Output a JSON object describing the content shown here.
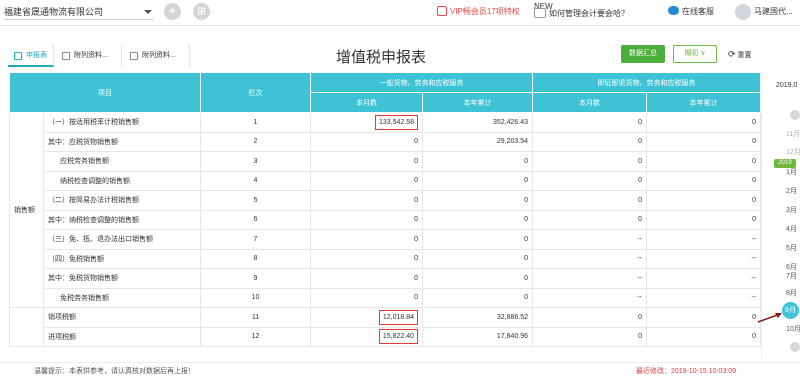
{
  "top": {
    "company": "福建省晟通物流有限公司",
    "add_glyph": "+",
    "apps_glyph": "⊞",
    "vip": "VIP畅会员17项特权",
    "tip_badge": "NEW",
    "tip": "如何管理会计要会哈？",
    "service": "在线客服",
    "user": "马建国代..."
  },
  "tabs": [
    "申报表",
    "附列资料...",
    "附列资料..."
  ],
  "title": "增值税申报表",
  "buttons": {
    "summary": "数据汇总",
    "period": "期初 ∨",
    "reset": "重置"
  },
  "table": {
    "h_item": "项目",
    "h_col": "栏次",
    "h_g1": "一般货物、劳务和应税服务",
    "h_g2": "即征即退货物、劳务和应税服务",
    "h_month": "本月数",
    "h_year": "本年累计",
    "group1": "销售额",
    "rows": [
      {
        "name": "（一）按适用税率计税销售额",
        "no": "1",
        "m1": "133,542.58",
        "y1": "352,426.43",
        "m2": "0",
        "y2": "0"
      },
      {
        "name": "其中：应税货物销售额",
        "no": "2",
        "m1": "0",
        "y1": "29,203.54",
        "m2": "0",
        "y2": "0"
      },
      {
        "name": "应税劳务销售额",
        "no": "3",
        "m1": "0",
        "y1": "0",
        "m2": "0",
        "y2": "0"
      },
      {
        "name": "纳税检查调整的销售额",
        "no": "4",
        "m1": "0",
        "y1": "0",
        "m2": "0",
        "y2": "0"
      },
      {
        "name": "（二）按简易办法计税销售额",
        "no": "5",
        "m1": "0",
        "y1": "0",
        "m2": "0",
        "y2": "0"
      },
      {
        "name": "其中：纳税检查调整的销售额",
        "no": "6",
        "m1": "0",
        "y1": "0",
        "m2": "0",
        "y2": "0"
      },
      {
        "name": "（三）免、抵、退办法出口销售额",
        "no": "7",
        "m1": "0",
        "y1": "0",
        "m2": "--",
        "y2": "--"
      },
      {
        "name": "（四）免税销售额",
        "no": "8",
        "m1": "0",
        "y1": "0",
        "m2": "--",
        "y2": "--"
      },
      {
        "name": "其中：免税货物销售额",
        "no": "9",
        "m1": "0",
        "y1": "0",
        "m2": "--",
        "y2": "--"
      },
      {
        "name": "免税劳务销售额",
        "no": "10",
        "m1": "0",
        "y1": "0",
        "m2": "--",
        "y2": "--"
      },
      {
        "name": "销项税额",
        "no": "11",
        "m1": "12,018.84",
        "y1": "32,886.52",
        "m2": "0",
        "y2": "0"
      },
      {
        "name": "进项税额",
        "no": "12",
        "m1": "15,822.40",
        "y1": "17,840.96",
        "m2": "0",
        "y2": "0"
      }
    ]
  },
  "side": {
    "year_top": "2019.0",
    "months_before": [
      "11月",
      "12月"
    ],
    "year_badge": "2019",
    "months": [
      "1月",
      "2月",
      "3月",
      "4月",
      "5月",
      "6月",
      "7月",
      "8月"
    ],
    "selected": "9月",
    "after": "10月"
  },
  "footer": {
    "left": "温馨提示：本表供参考，请认真核对数据后再上报！",
    "right": "最近修改：2019-10-15 10:03:09"
  }
}
